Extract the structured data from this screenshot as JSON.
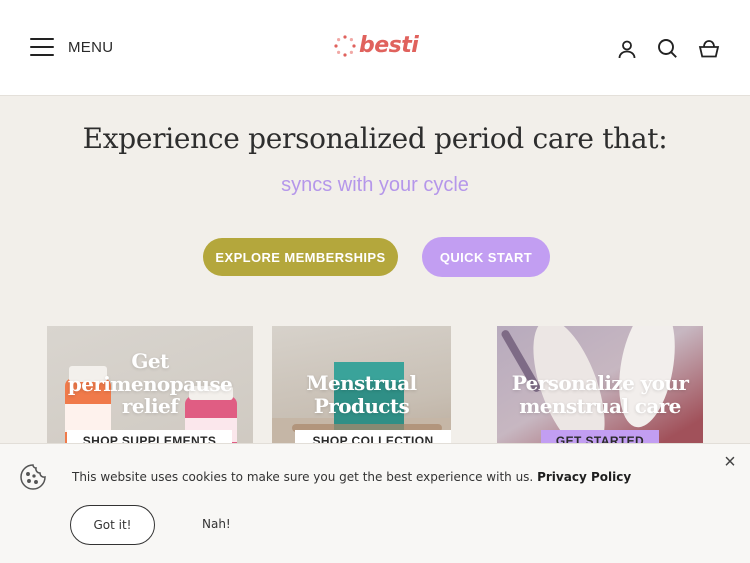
{
  "header": {
    "menu_label": "MENU",
    "logo_text": "besti",
    "icons": [
      "account-icon",
      "search-icon",
      "cart-icon"
    ]
  },
  "hero": {
    "title": "Experience personalized period care that:",
    "subtitle": "syncs with your cycle",
    "explore_label": "EXPLORE MEMBERSHIPS",
    "quick_start_label": "QUICK START"
  },
  "cards": [
    {
      "title_line1": "Get",
      "title_line2": "perimenopause",
      "title_line3": "relief",
      "button": "SHOP SUPPLEMENTS"
    },
    {
      "title_line1": "Menstrual",
      "title_line2": "Products",
      "button": "SHOP COLLECTION"
    },
    {
      "title_line1": "Personalize your",
      "title_line2": "menstrual care",
      "button": "GET STARTED"
    }
  ],
  "cookie": {
    "message": "This website uses cookies to make sure you get the best experience with us.",
    "policy_link": "Privacy Policy",
    "accept_label": "Got it!",
    "decline_label": "Nah!",
    "close_symbol": "×"
  },
  "colors": {
    "brand_coral": "#e0625d",
    "olive_button": "#b4a73c",
    "lavender_button": "#c29ef2",
    "subtitle_purple": "#b597ea",
    "page_bg": "#f2efea"
  }
}
